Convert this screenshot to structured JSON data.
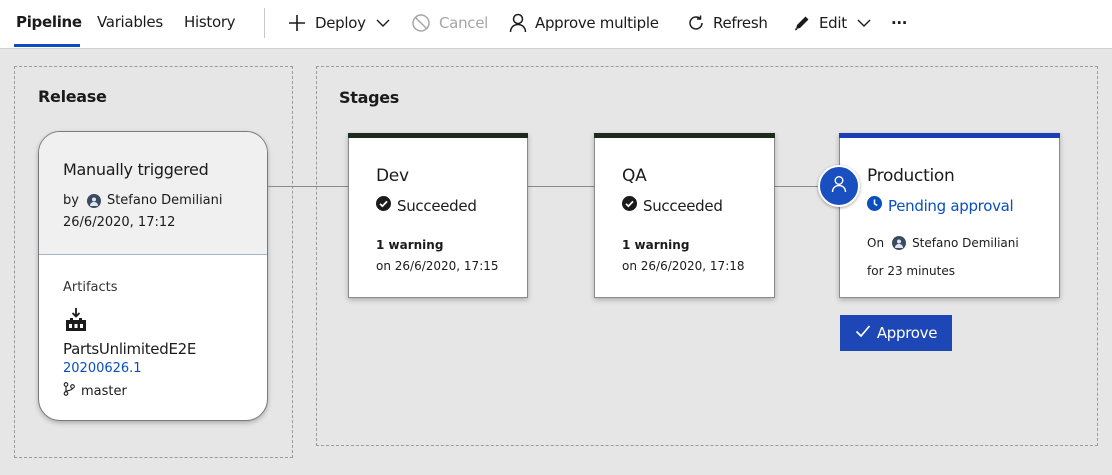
{
  "tabs": [
    {
      "label": "Pipeline",
      "active": true
    },
    {
      "label": "Variables",
      "active": false
    },
    {
      "label": "History",
      "active": false
    }
  ],
  "toolbar": {
    "deploy_label": "Deploy",
    "cancel_label": "Cancel",
    "approve_multiple_label": "Approve multiple",
    "refresh_label": "Refresh",
    "edit_label": "Edit",
    "more_label": "···"
  },
  "release": {
    "title": "Release",
    "trigger": "Manually triggered",
    "by_prefix": "by",
    "user": "Stefano Demiliani",
    "date": "26/6/2020, 17:12",
    "artifacts_label": "Artifacts",
    "artifact_name": "PartsUnlimitedE2E",
    "build": "20200626.1",
    "branch": "master"
  },
  "stages_panel": {
    "title": "Stages"
  },
  "stages": [
    {
      "name": "Dev",
      "status": "Succeeded",
      "warning": "1 warning",
      "when": "on 26/6/2020, 17:15"
    },
    {
      "name": "QA",
      "status": "Succeeded",
      "warning": "1 warning",
      "when": "on 26/6/2020, 17:18"
    },
    {
      "name": "Production",
      "status": "Pending approval",
      "on_prefix": "On",
      "user": "Stefano Demiliani",
      "duration": "for 23 minutes"
    }
  ],
  "approve_label": "Approve",
  "colors": {
    "accent": "#0a4fbf",
    "success_bar": "#1e2a1e",
    "pending_bar": "#1a3fb5",
    "approve_button": "#1d47b6"
  },
  "icons": {
    "deploy": "plus-icon",
    "cancel": "cancel-icon",
    "approve_multiple": "person-icon",
    "refresh": "refresh-icon",
    "edit": "pencil-icon",
    "succeeded": "check-circle-icon",
    "pending": "clock-icon",
    "artifact": "build-artifact-icon",
    "branch": "branch-icon",
    "approver": "person-icon"
  }
}
